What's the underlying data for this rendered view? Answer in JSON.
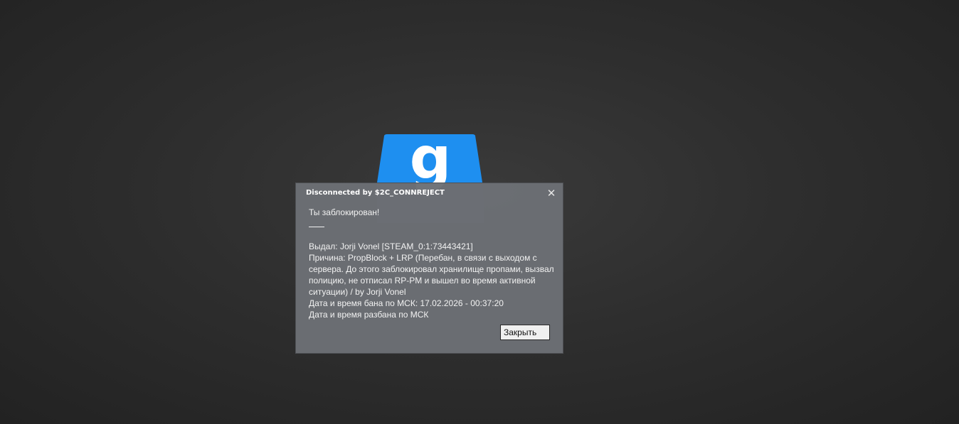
{
  "logo": {
    "name": "gmod-logo",
    "glyph": "g",
    "color": "#1e88e5"
  },
  "dialog": {
    "title": "Disconnected by $2C_CONNREJECT",
    "close_symbol": "✕",
    "message": {
      "line1": "Ты заблокирован!",
      "separator": "___",
      "issuer": "Выдал: Jorji Vonel [STEAM_0:1:73443421]",
      "reason": "Причина: PropBlock + LRP (Перебан, в связи с выходом с сервера. До этого заблокировал хранилище пропами, вызвал полицию, не отписал RP-PM и вышел во время активной ситуации) / by Jorji Vonel",
      "ban_time": "Дата и время бана по МСК: 17.02.2026 - 00:37:20",
      "unban_time": "Дата и время разбана по МСК"
    },
    "button_label": "Закрыть"
  }
}
